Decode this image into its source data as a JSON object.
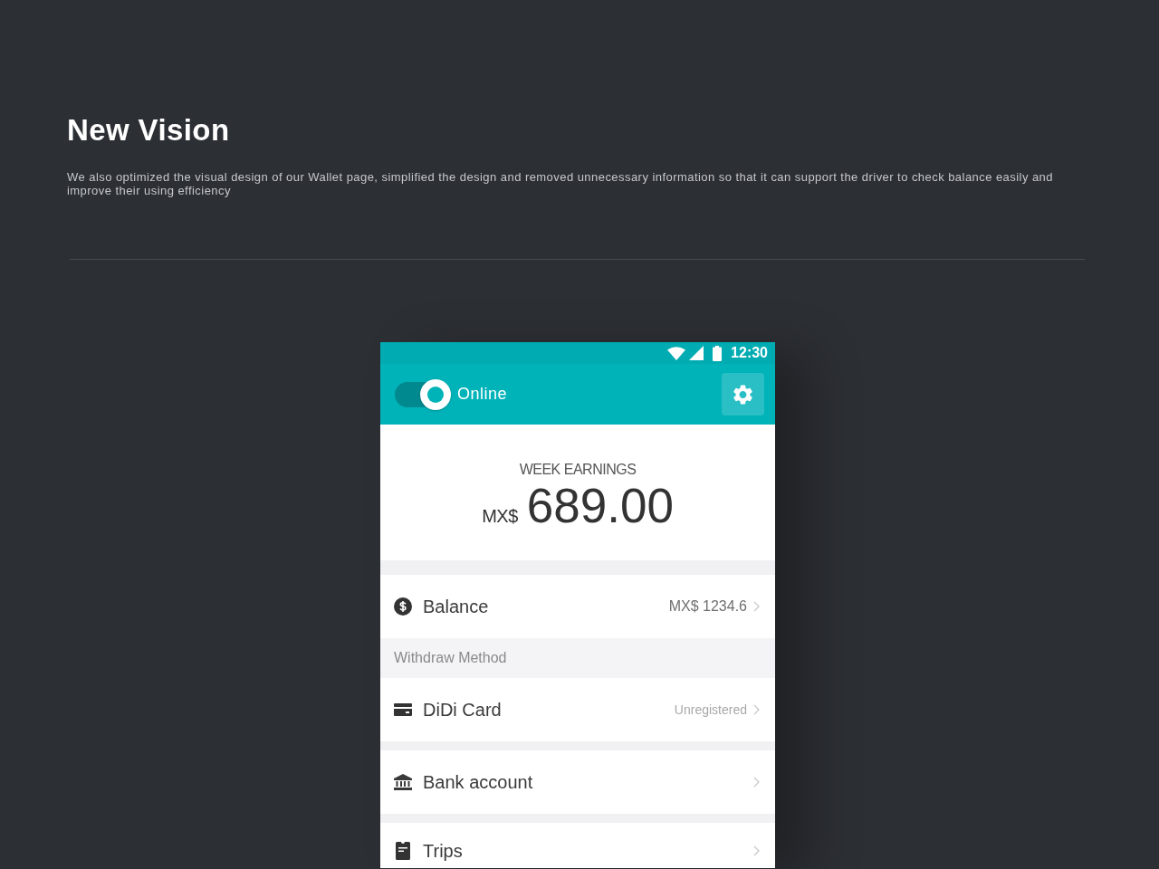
{
  "intro": {
    "title": "New Vision",
    "description": "We also optimized the visual design of our Wallet page, simplified the design and removed unnecessary information so that it can support the driver to check balance easily and improve their using efficiency"
  },
  "phone": {
    "status_bar": {
      "time": "12:30"
    },
    "top_bar": {
      "online_toggle": {
        "label": "Online",
        "on": true
      }
    },
    "earnings": {
      "label": "WEEK EARNINGS",
      "currency": "MX$",
      "amount": "689.00"
    },
    "list": [
      {
        "kind": "row",
        "label": "Balance",
        "value": "MX$ 1234.6"
      },
      {
        "kind": "header",
        "label": "Withdraw Method"
      },
      {
        "kind": "row",
        "label": "DiDi Card",
        "status": "Unregistered"
      },
      {
        "kind": "row",
        "label": "Bank account"
      },
      {
        "kind": "row",
        "label": "Trips"
      }
    ]
  }
}
